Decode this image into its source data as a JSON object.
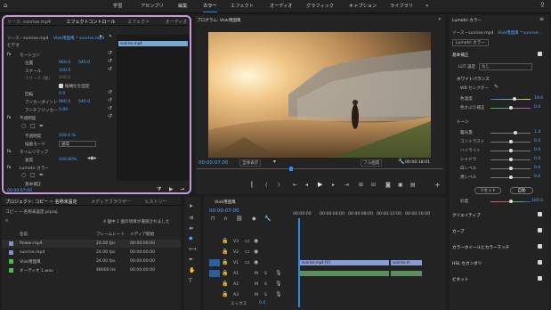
{
  "topbar": {
    "items": [
      "学習",
      "アセンブリ",
      "編集",
      "カラー",
      "エフェクト",
      "オーディオ",
      "グラフィック",
      "キャプション",
      "ライブラリ"
    ],
    "active_index": 3,
    "menu_icon": "chevron-right-icon",
    "home_icon": "home-icon",
    "export_icon": "share-icon"
  },
  "effect_controls": {
    "tabs": [
      "ソース: sunrise.mp4",
      "エフェクトコントロール",
      "エフェクト",
      "オーディオ"
    ],
    "source_label": "ソース・sunrise.mp4",
    "sequence_label": "Vlok用国風 * sunrise.mp4",
    "clip_label": "sunrise.mp4",
    "section_video": "ビデオ",
    "rows": [
      {
        "label": "モーション"
      },
      {
        "label": "位置",
        "v1": "960.0",
        "v2": "540.0"
      },
      {
        "label": "スケール",
        "v1": "100.0"
      },
      {
        "label": "スケール (幅)",
        "v1": "100.0"
      },
      {
        "label": "縦横比を固定"
      },
      {
        "label": "回転",
        "v1": "0.0"
      },
      {
        "label": "アンカーポイント",
        "v1": "960.0",
        "v2": "540.0"
      },
      {
        "label": "アンチフリッカー",
        "v1": "0.00"
      },
      {
        "label": "不透明度"
      },
      {
        "label": "不透明度",
        "v1": "100.0 %"
      },
      {
        "label": "描画モード",
        "v1": "通常"
      },
      {
        "label": "タイムリマップ"
      },
      {
        "label": "速度",
        "v1": "100.00%"
      },
      {
        "label": "Lumetri カラー"
      },
      {
        "label": "基本補正"
      }
    ],
    "timecode": "00:00:07:00"
  },
  "program": {
    "title": "プログラム: Vlok用国風",
    "timecode": "00:00:07:00",
    "zoom": "全体表示",
    "quality": "フル画質",
    "duration": "00:00:18:01"
  },
  "lumetri": {
    "title": "Lumetri カラー",
    "source": "ソース・sunrise.mp4",
    "sequence": "Vlok用国風 * sunrise…",
    "effect": "Lumetri カラー",
    "basic": "基本補正",
    "lut_label": "LUT 設定",
    "lut_value": "なし",
    "wb_header": "ホワイトバランス",
    "wb_selector": "WB セレクター",
    "temp_label": "色温度",
    "temp_value": "19.6",
    "tint_label": "色かぶり補正",
    "tint_value": "0.0",
    "tone_header": "トーン",
    "tone": [
      {
        "label": "露光量",
        "value": "1.4"
      },
      {
        "label": "コントラスト",
        "value": "0.0"
      },
      {
        "label": "ハイライト",
        "value": "0.0"
      },
      {
        "label": "シャドウ",
        "value": "0.0"
      },
      {
        "label": "白レベル",
        "value": "0.0"
      },
      {
        "label": "黒レベル",
        "value": "0.0"
      }
    ],
    "reset": "リセット",
    "auto": "自動",
    "saturation_label": "彩度",
    "saturation_value": "100.0",
    "sections": [
      "クリエイティブ",
      "カーブ",
      "カラーホイールとカラーマッチ",
      "HSL セカンダリ",
      "ビネット"
    ]
  },
  "project": {
    "tabs": [
      "プロジェクト: コピー ~ 名称未設定",
      "メディアブラウザー",
      "ヒストリー"
    ],
    "path": "コピー ~ 名称未設定.prproj",
    "selection": "4 個中 1 個の項目が選択されました",
    "headers": [
      "名前",
      "フレームレート",
      "メディア開始"
    ],
    "rows": [
      {
        "name": "flower.mp4",
        "fps": "24.00 fps",
        "start": "00:00:00:00",
        "color": "#8b8cc9"
      },
      {
        "name": "sunrise.mp4",
        "fps": "24.00 fps",
        "start": "00:00:00:00",
        "color": "#8b8cc9"
      },
      {
        "name": "Vlok用国風",
        "fps": "24.00 fps",
        "start": "00:00:00:00",
        "color": "#47c24f"
      },
      {
        "name": "オーディオ 1.wav",
        "fps": "48000 Hz",
        "start": "00:00:00:00",
        "color": "#47c24f"
      }
    ]
  },
  "timeline": {
    "title": "Vlok用国風",
    "timecode": "00:00:07:00",
    "ruler": [
      "00:00:00",
      "00:00:04:00",
      "00:00:08:00",
      "00:00:12:00",
      "00:00:16:00"
    ],
    "tracks": [
      "V3",
      "V2",
      "V1",
      "A1",
      "A2",
      "A3"
    ],
    "clip_v1": "sunrise.mp4 [V]",
    "clip_v1b": "sunrise.m",
    "mix_label": "ミックス",
    "mix_value": "0.0"
  }
}
